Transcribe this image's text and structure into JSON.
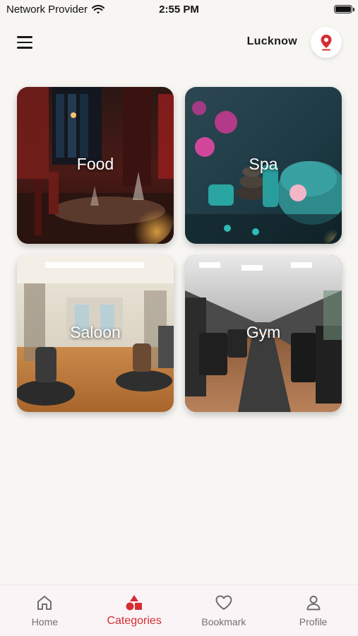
{
  "status_bar": {
    "carrier": "Network Provider",
    "time": "2:55 PM",
    "battery_level": 1.0
  },
  "header": {
    "city": "Lucknow",
    "menu_icon": "hamburger-icon",
    "location_icon": "map-pin-icon"
  },
  "categories": [
    {
      "label": "Food"
    },
    {
      "label": "Spa"
    },
    {
      "label": "Saloon"
    },
    {
      "label": "Gym"
    }
  ],
  "bottom_nav": {
    "items": [
      {
        "label": "Home",
        "icon": "home-icon",
        "active": false
      },
      {
        "label": "Categories",
        "icon": "categories-icon",
        "active": true
      },
      {
        "label": "Bookmark",
        "icon": "heart-icon",
        "active": false
      },
      {
        "label": "Profile",
        "icon": "user-icon",
        "active": false
      }
    ]
  },
  "colors": {
    "accent": "#d42e32",
    "background": "#f7f6f3",
    "nav_background": "#fbf4f7",
    "inactive": "#707070"
  }
}
